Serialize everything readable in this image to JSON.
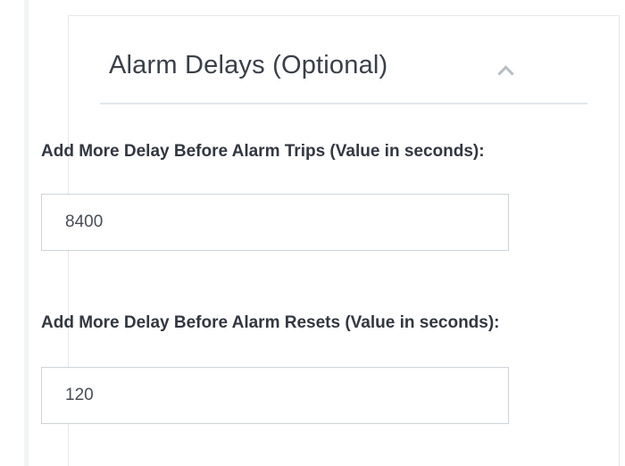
{
  "section": {
    "title": "Alarm Delays (Optional)",
    "collapse_icon": "chevron-up-icon"
  },
  "fields": [
    {
      "label": "Add More Delay Before Alarm Trips (Value in seconds):",
      "value": "8400"
    },
    {
      "label": "Add More Delay Before Alarm Resets (Value in seconds):",
      "value": "120"
    }
  ],
  "colors": {
    "border": "#cfd3d9",
    "header_rule": "#e3e7ed",
    "text": "#333740"
  }
}
